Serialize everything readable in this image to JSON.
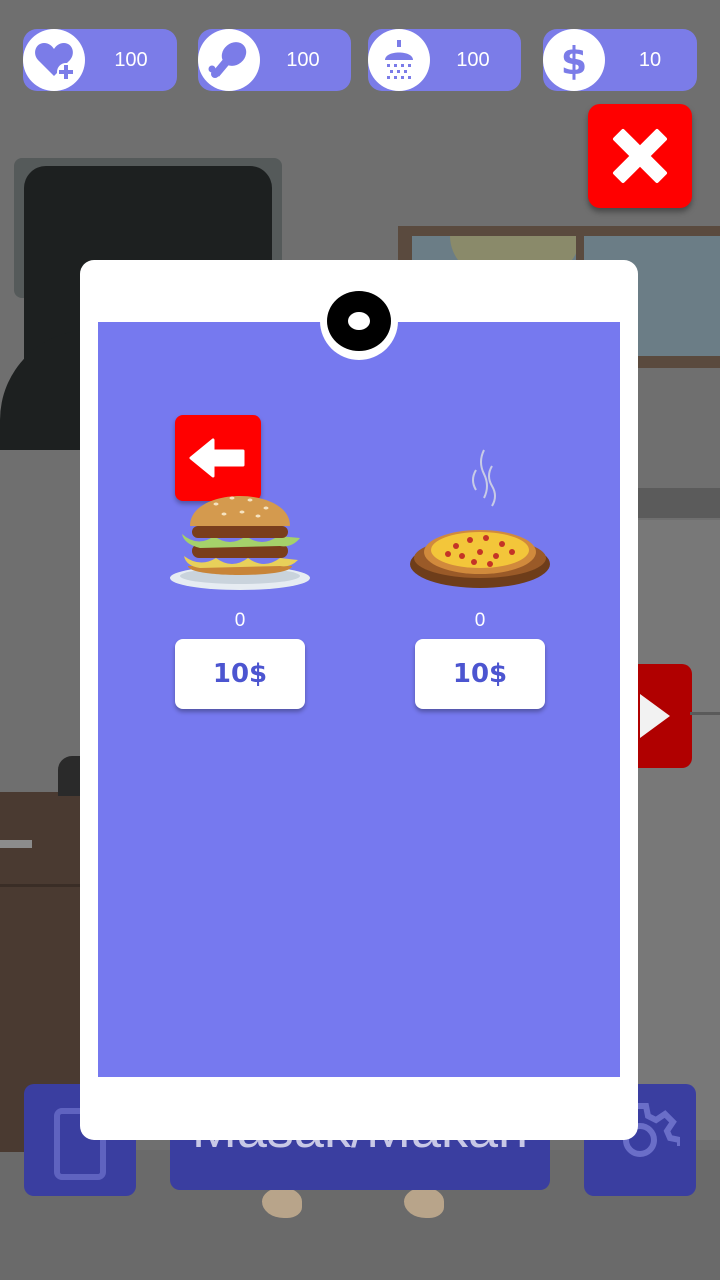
{
  "stats": [
    {
      "icon": "heart-plus-icon",
      "value": "100"
    },
    {
      "icon": "chicken-leg-icon",
      "value": "100"
    },
    {
      "icon": "shower-icon",
      "value": "100"
    },
    {
      "icon": "dollar-icon",
      "value": "10"
    }
  ],
  "bottom_bar": {
    "label": "Masak/Makan"
  },
  "shop": {
    "items": [
      {
        "name": "burger",
        "icon": "burger-icon",
        "count": "0",
        "price": "10$"
      },
      {
        "name": "pizza",
        "icon": "pizza-icon",
        "count": "0",
        "price": "10$"
      }
    ]
  },
  "colors": {
    "accent": "#7b7ce8",
    "screen": "#7679ef",
    "danger": "#ff0000",
    "price_text": "#4c55d0"
  }
}
